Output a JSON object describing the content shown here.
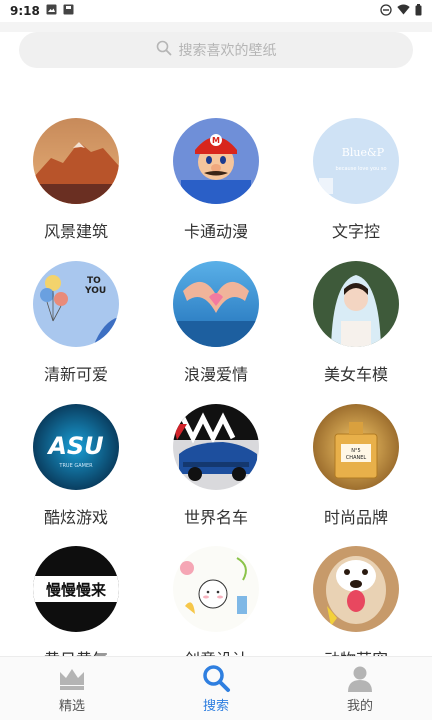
{
  "status_bar": {
    "time": "9:18",
    "left_icons": [
      "gallery-icon",
      "save-icon"
    ],
    "right_icons": [
      "do-not-disturb-icon",
      "wifi-icon",
      "battery-icon"
    ]
  },
  "search": {
    "placeholder": "搜索喜欢的壁纸",
    "icon": "search-icon"
  },
  "categories": [
    {
      "label": "风景建筑"
    },
    {
      "label": "卡通动漫"
    },
    {
      "label": "文字控"
    },
    {
      "label": "清新可爱"
    },
    {
      "label": "浪漫爱情"
    },
    {
      "label": "美女车模"
    },
    {
      "label": "酷炫游戏"
    },
    {
      "label": "世界名车"
    },
    {
      "label": "时尚品牌"
    },
    {
      "label": "黄日黄气"
    },
    {
      "label": "创意设计"
    },
    {
      "label": "动物萌宠"
    }
  ],
  "thumb_text": {
    "blue_p": "Blue&P",
    "blue_p_sub": "because love you so",
    "to_you": "TO\nYOU",
    "asu": "ASU",
    "asu_sub": "TRUE GAMER",
    "chanel": "CHANEL",
    "chanel_no": "N°5",
    "slow": "慢慢慢来"
  },
  "bottom_nav": [
    {
      "label": "精选",
      "icon": "crown-icon",
      "active": false
    },
    {
      "label": "搜索",
      "icon": "search-icon",
      "active": true
    },
    {
      "label": "我的",
      "icon": "person-icon",
      "active": false
    }
  ],
  "colors": {
    "accent": "#2f7fe0",
    "inactive": "#9a9a9a",
    "search_bg": "#f0f0f0"
  }
}
